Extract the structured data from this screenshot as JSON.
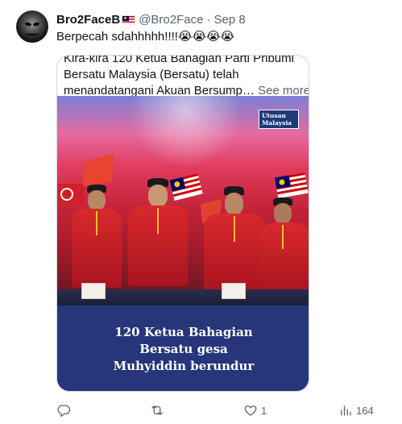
{
  "tweet": {
    "display_name": "Bro2FaceB",
    "handle": "@Bro2Face",
    "separator": "·",
    "date": "Sep 8",
    "text": "Berpecah sdahhhhh!!!!😭😭😭😭",
    "flag_icon": "malaysia-flag-icon"
  },
  "card": {
    "lines": [
      "Kira-kira 120 Ketua Bahagian Parti Pribumi",
      "Bersatu Malaysia (Bersatu) telah",
      "menandatangani Akuan Bersump…"
    ],
    "see_more": "See more",
    "logo_line1": "Utusan",
    "logo_line2": "Malaysia",
    "caption": [
      "120 Ketua Bahagian",
      "Bersatu gesa",
      "Muhyiddin berundur"
    ]
  },
  "actions": {
    "reply_icon": "reply-icon",
    "retweet_icon": "retweet-icon",
    "like_icon": "heart-icon",
    "like_count": "1",
    "views_icon": "views-icon",
    "views_count": "164"
  },
  "colors": {
    "caption_bg": "#27357a",
    "secondary_text": "#536471",
    "border": "#cfd9de"
  }
}
